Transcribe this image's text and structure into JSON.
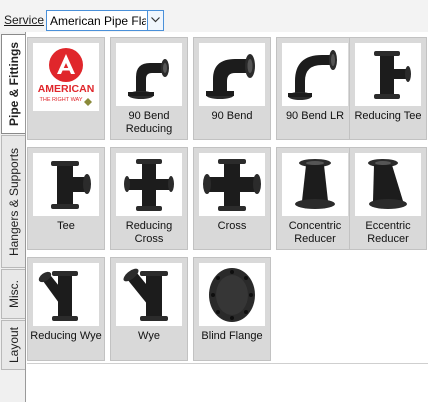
{
  "toolbar": {
    "service_label": "Service",
    "service_value": "American Pipe Flan"
  },
  "tabs": [
    {
      "label": "Pipe & Fittings",
      "active": true
    },
    {
      "label": "Hangers & Supports",
      "active": false
    },
    {
      "label": "Misc.",
      "active": false
    },
    {
      "label": "Layout",
      "active": false
    }
  ],
  "logo": {
    "brand": "AMERICAN",
    "tagline": "THE RIGHT WAY"
  },
  "items": [
    {
      "label": "90 Bend Reducing",
      "icon": "elbow-reducing-icon"
    },
    {
      "label": "90 Bend",
      "icon": "elbow-icon"
    },
    {
      "label": "90 Bend LR",
      "icon": "elbow-long-radius-icon"
    },
    {
      "label": "Reducing Tee",
      "icon": "reducing-tee-icon"
    },
    {
      "label": "Tee",
      "icon": "tee-icon"
    },
    {
      "label": "Reducing Cross",
      "icon": "reducing-cross-icon"
    },
    {
      "label": "Cross",
      "icon": "cross-icon"
    },
    {
      "label": "Concentric Reducer",
      "icon": "concentric-reducer-icon"
    },
    {
      "label": "Eccentric Reducer",
      "icon": "eccentric-reducer-icon"
    },
    {
      "label": "Reducing Wye",
      "icon": "reducing-wye-icon"
    },
    {
      "label": "Wye",
      "icon": "wye-icon"
    },
    {
      "label": "Blind Flange",
      "icon": "blind-flange-icon"
    }
  ],
  "colors": {
    "brand_red": "#e0262b",
    "selection_blue": "#4a90d9",
    "tile_bg": "#d9d9d9",
    "fitting_black": "#1c1c1c"
  }
}
